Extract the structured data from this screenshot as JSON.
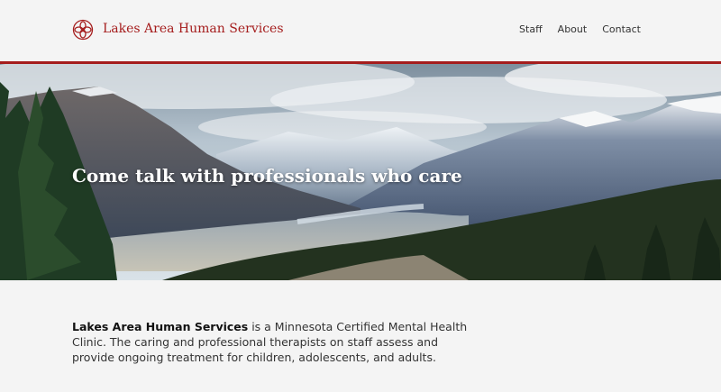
{
  "header": {
    "site_name": "Lakes Area Human Services",
    "brand_color": "#a51d1d",
    "logo_icon": "flower-logo-icon",
    "nav": [
      {
        "label": "Staff"
      },
      {
        "label": "About"
      },
      {
        "label": "Contact"
      }
    ]
  },
  "hero": {
    "title": "Come talk with professionals who care",
    "image": "mountain-lake-landscape"
  },
  "intro": {
    "org_name": "Lakes Area Human Services",
    "text": " is a Minnesota Certified Mental Health Clinic. The caring and professional therapists on staff assess and provide ongoing treatment for children, adolescents, and adults."
  }
}
